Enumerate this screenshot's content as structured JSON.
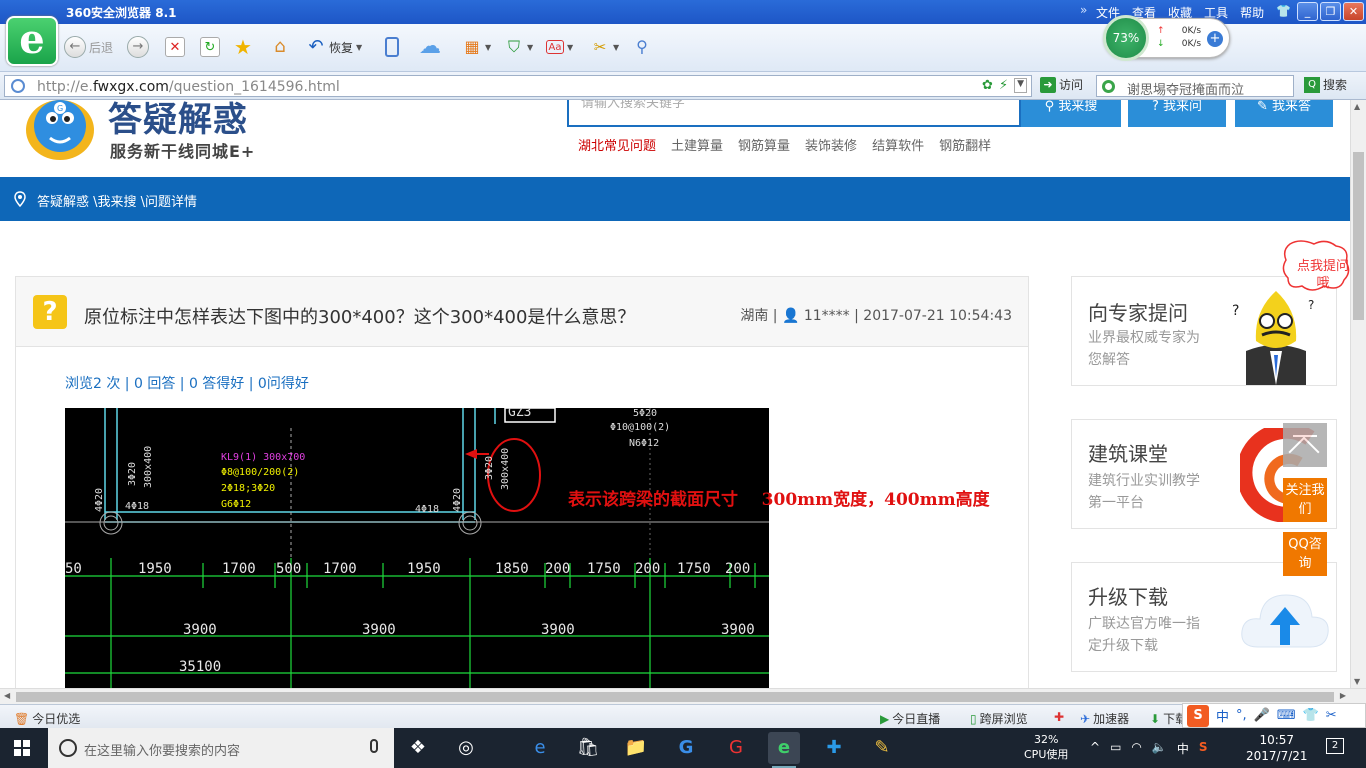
{
  "browser": {
    "title": "360安全浏览器 8.1",
    "menus": [
      "文件",
      "查看",
      "收藏",
      "工具",
      "帮助"
    ],
    "toolbar": {
      "back_label": "后退",
      "restore_label": "恢复"
    },
    "speed": {
      "percent": "73%",
      "up": "0K/s",
      "down": "0K/s"
    },
    "address": {
      "url_prefix": "http://e.",
      "url_domain": "fwxgx.com",
      "url_path": "/question_1614596.html",
      "go_label": "访问"
    },
    "search": {
      "text": "谢思埸夺冠掩面而泣",
      "button_label": "搜索"
    }
  },
  "site": {
    "logo_text": "答疑解惑",
    "slogan": "服务新干线同城E+",
    "search_placeholder": "请输入搜索关键字",
    "buttons": [
      "我来搜",
      "我来问",
      "我来答"
    ],
    "quick_links": [
      "湖北常见问题",
      "土建算量",
      "钢筋算量",
      "装饰装修",
      "结算软件",
      "钢筋翻样"
    ],
    "breadcrumb": "答疑解惑 \\我来搜 \\问题详情"
  },
  "question": {
    "title": "原位标注中怎样表达下图中的300*400？这个300*400是什么意思？",
    "region": "湖南",
    "user": "11****",
    "time": "2017-07-21 10:54:43",
    "stats": "浏览2 次 | 0 回答 | 0 答得好 | 0问得好",
    "annotation": "表示该跨梁的截面尺寸    300mm宽度，400mm高度"
  },
  "cad": {
    "label_kl": "KL9(1) 300x700",
    "label_stirrup": "Φ8@100/200(2)",
    "label_bars": "2Φ18;3Φ20",
    "label_g": "G6Φ12",
    "label_3phi20": "3Φ20",
    "label_300x400_left": "300x400",
    "label_4phi20_left": "4Φ20",
    "label_4phi18_left": "4Φ18",
    "label_4phi18_right": "4Φ18",
    "label_4phi20_right": "4Φ20",
    "label_3phi20_b": "3Φ20",
    "label_300x400_b": "300x400",
    "label_gz": "GZ3",
    "label_5phi20": "5Φ20",
    "label_phi10": "Φ10@100(2)",
    "label_n6": "N6Φ12",
    "dims_row1": [
      "50",
      "1950",
      "1700",
      "500",
      "1700",
      "1950",
      "1850",
      "200",
      "1750",
      "200",
      "1750",
      "200"
    ],
    "dims_row2": [
      "3900",
      "3900",
      "3900",
      "3900"
    ],
    "dim_total": "35100"
  },
  "sidebar": [
    {
      "title": "向专家提问",
      "desc": "业界最权威专家为您解答"
    },
    {
      "title": "建筑课堂",
      "desc": "建筑行业实训教学第一平台"
    },
    {
      "title": "升级下载",
      "desc": "广联达官方唯一指定升级下载"
    }
  ],
  "floating": {
    "ask_bubble": "点我提问哦",
    "follow": "关注我们",
    "qq": "QQ咨询"
  },
  "statusbar": {
    "left": "今日优选",
    "live": "今日直播",
    "cross": "跨屏浏览",
    "accel": "加速器",
    "download": "下载"
  },
  "ime": {
    "mode": "中"
  },
  "taskbar": {
    "search_placeholder": "在这里输入你要搜索的内容",
    "cpu_percent": "32%",
    "cpu_label": "CPU使用",
    "ime": "中",
    "time": "10:57",
    "date": "2017/7/21",
    "notifications": "2"
  }
}
